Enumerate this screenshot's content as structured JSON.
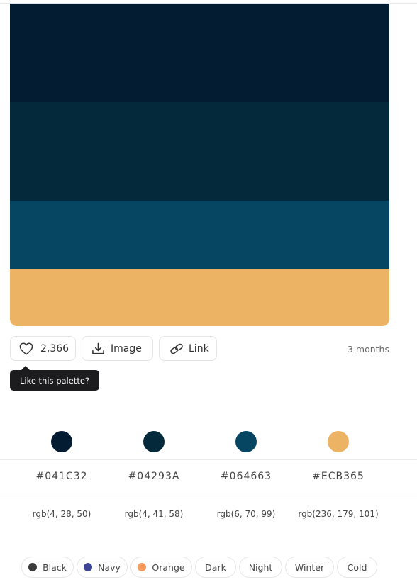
{
  "palette": {
    "colors": [
      {
        "hex": "#041C32",
        "rgb": "rgb(4, 28, 50)"
      },
      {
        "hex": "#04293A",
        "rgb": "rgb(4, 41, 58)"
      },
      {
        "hex": "#064663",
        "rgb": "rgb(6, 70, 99)"
      },
      {
        "hex": "#ECB365",
        "rgb": "rgb(236, 179, 101)"
      }
    ]
  },
  "actions": {
    "like_count": "2,366",
    "image_label": "Image",
    "link_label": "Link",
    "like_icon": "heart-icon",
    "image_icon": "download-icon",
    "link_icon": "link-icon"
  },
  "meta": {
    "time_ago": "3 months"
  },
  "tooltip": {
    "text": "Like this palette?"
  },
  "colors_display": {
    "hex_0": "#041C32",
    "hex_1": "#04293A",
    "hex_2": "#064663",
    "hex_3": "#ECB365",
    "rgb_0": "rgb(4, 28, 50)",
    "rgb_1": "rgb(4, 41, 58)",
    "rgb_2": "rgb(6, 70, 99)",
    "rgb_3": "rgb(236, 179, 101)"
  },
  "tags": [
    {
      "label": "Black",
      "dot_color": "#3a3a3a"
    },
    {
      "label": "Navy",
      "dot_color": "#3e4496"
    },
    {
      "label": "Orange",
      "dot_color": "#f59a5c"
    },
    {
      "label": "Dark"
    },
    {
      "label": "Night"
    },
    {
      "label": "Winter"
    },
    {
      "label": "Cold"
    }
  ]
}
